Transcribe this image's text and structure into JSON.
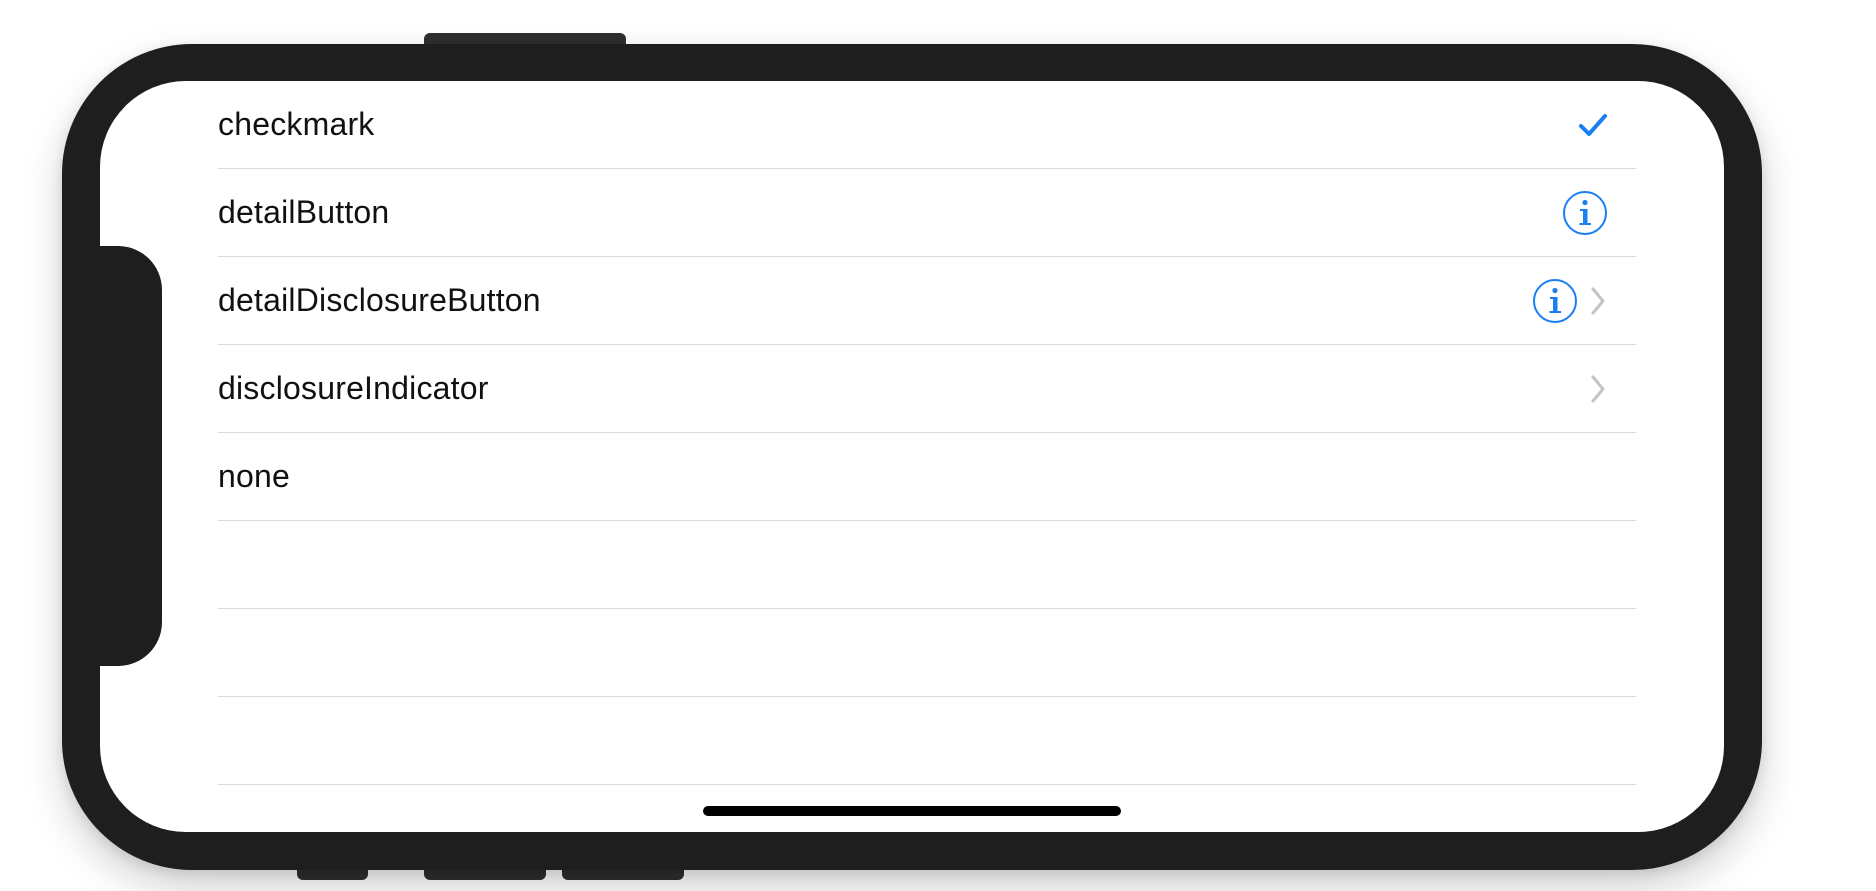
{
  "colors": {
    "accent": "#1a7ff2",
    "chevron": "#c4c4c7",
    "separator": "#d9d9dc",
    "text": "#111111",
    "device_frame": "#1e1e1e"
  },
  "table": {
    "rows": [
      {
        "label": "checkmark",
        "accessory": "checkmark-icon"
      },
      {
        "label": "detailButton",
        "accessory": "info-icon"
      },
      {
        "label": "detailDisclosureButton",
        "accessory": "info-icon + chevron-right-icon"
      },
      {
        "label": "disclosureIndicator",
        "accessory": "chevron-right-icon"
      },
      {
        "label": "none",
        "accessory": ""
      }
    ]
  }
}
